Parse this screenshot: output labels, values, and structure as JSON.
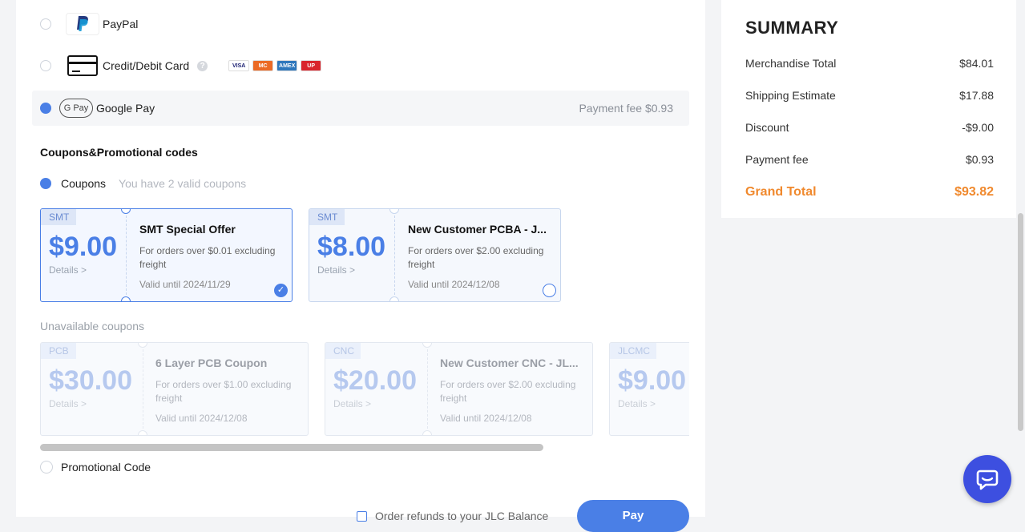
{
  "payment": {
    "paypal_label": "PayPal",
    "card_label": "Credit/Debit Card",
    "help_glyph": "?",
    "card_brands": [
      {
        "name": "VISA",
        "bg": "#ffffff",
        "fg": "#1a1f71"
      },
      {
        "name": "MC",
        "bg": "#eb6a25",
        "fg": "#ffffff"
      },
      {
        "name": "AMEX",
        "bg": "#2e77bc",
        "fg": "#ffffff"
      },
      {
        "name": "UP",
        "bg": "#d9252d",
        "fg": "#ffffff"
      }
    ],
    "gpay_badge": "G Pay",
    "gpay_label": "Google Pay",
    "gpay_fee": "Payment fee $0.93",
    "selected": "google-pay"
  },
  "coupons": {
    "section_title": "Coupons&Promotional codes",
    "radio_label": "Coupons",
    "valid_note": "You have 2 valid coupons",
    "available": [
      {
        "tag": "SMT",
        "amount": "$9.00",
        "details": "Details >",
        "name": "SMT Special Offer",
        "desc": "For orders over $0.01 excluding freight",
        "valid": "Valid until 2024/11/29",
        "selected": true
      },
      {
        "tag": "SMT",
        "amount": "$8.00",
        "details": "Details >",
        "name": "New Customer PCBA - J...",
        "desc": "For orders over $2.00 excluding freight",
        "valid": "Valid until 2024/12/08",
        "selected": false
      }
    ],
    "unavailable_label": "Unavailable coupons",
    "unavailable": [
      {
        "tag": "PCB",
        "amount": "$30.00",
        "details": "Details >",
        "name": "6 Layer PCB Coupon",
        "desc": "For orders over $1.00 excluding freight",
        "valid": "Valid until 2024/12/08"
      },
      {
        "tag": "CNC",
        "amount": "$20.00",
        "details": "Details >",
        "name": "New Customer CNC - JL...",
        "desc": "For orders over $2.00 excluding freight",
        "valid": "Valid until 2024/12/08"
      },
      {
        "tag": "JLCMC",
        "amount": "$9.00",
        "details": "Details >",
        "name": "",
        "desc": "",
        "valid": ""
      }
    ],
    "promo_label": "Promotional Code"
  },
  "footer": {
    "refund_label": "Order refunds to your JLC Balance",
    "pay_button": "Pay"
  },
  "summary": {
    "title": "SUMMARY",
    "rows": [
      {
        "label": "Merchandise Total",
        "value": "$84.01"
      },
      {
        "label": "Shipping Estimate",
        "value": "$17.88"
      },
      {
        "label": "Discount",
        "value": "-$9.00"
      },
      {
        "label": "Payment fee",
        "value": "$0.93"
      }
    ],
    "grand_label": "Grand Total",
    "grand_value": "$93.82"
  },
  "colors": {
    "accent": "#4a7fe6",
    "grand_total": "#f0892d",
    "chat": "#3d4fe0"
  },
  "icons": [
    "paypal-icon",
    "credit-card-icon",
    "help-icon",
    "google-pay-icon",
    "check-icon",
    "chat-icon"
  ]
}
